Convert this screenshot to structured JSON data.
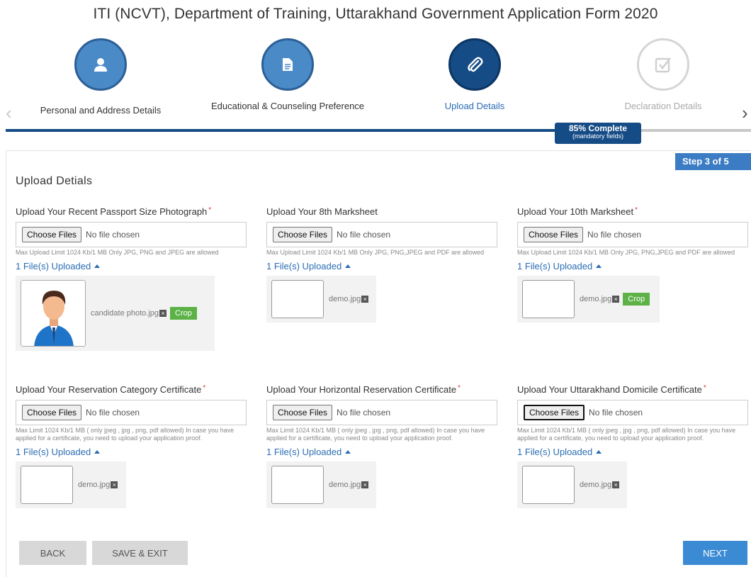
{
  "page": {
    "title": "ITI (NCVT), Department of Training, Uttarakhand Government Application Form 2020"
  },
  "stepper": {
    "steps": [
      {
        "label": "Personal and Address Details",
        "icon": "user-icon",
        "state": "done"
      },
      {
        "label": "Educational & Counseling Preference",
        "icon": "document-icon",
        "state": "done"
      },
      {
        "label": "Upload Details",
        "icon": "paperclip-icon",
        "state": "active"
      },
      {
        "label": "Declaration Details",
        "icon": "checkbox-icon",
        "state": "pending"
      }
    ],
    "progress": {
      "percent": 85,
      "label": "85% Complete",
      "sublabel": "(mandatory fields)"
    }
  },
  "form": {
    "step_badge": "Step 3 of 5",
    "section_title": "Upload Detials",
    "choose_label": "Choose Files",
    "no_file_label": "No file chosen",
    "fields": [
      {
        "label": "Upload Your Recent Passport Size Photograph",
        "required": true,
        "hint": "Max Upload Limit 1024 Kb/1 MB Only JPG, PNG and JPEG are allowed",
        "uploaded": "1 File(s) Uploaded",
        "file": "candidate photo.jpg",
        "crop": "Crop"
      },
      {
        "label": "Upload Your 8th Marksheet",
        "required": false,
        "hint": "Max Upload Limit 1024 Kb/1 MB Only JPG, PNG,JPEG and PDF are allowed",
        "uploaded": "1 File(s) Uploaded",
        "file": "demo.jpg"
      },
      {
        "label": "Upload Your 10th Marksheet",
        "required": true,
        "hint": "Max Upload Limit 1024 Kb/1 MB Only JPG, PNG,JPEG and PDF are allowed",
        "uploaded": "1 File(s) Uploaded",
        "file": "demo.jpg",
        "crop": "Crop"
      },
      {
        "label": "Upload Your Reservation Category Certificate",
        "required": true,
        "hint": "Max Limit 1024 Kb/1 MB ( only jpeg , jpg , png, pdf allowed) In case you have applied for a certificate, you need to upload your application proof.",
        "uploaded": "1 File(s) Uploaded",
        "file": "demo.jpg"
      },
      {
        "label": "Upload Your Horizontal Reservation Certificate",
        "required": true,
        "hint": "Max Limit 1024 Kb/1 MB ( only jpeg , jpg , png, pdf allowed) In case you have applied for a certificate, you need to upload your application proof.",
        "uploaded": "1 File(s) Uploaded",
        "file": "demo.jpg"
      },
      {
        "label": "Upload Your Uttarakhand Domicile Certificate",
        "required": true,
        "hint": "Max Limit 1024 Kb/1 MB ( only jpeg , jpg , png, pdf allowed) In case you have applied for a certificate, you need to upload your application proof.",
        "uploaded": "1 File(s) Uploaded",
        "file": "demo.jpg"
      }
    ]
  },
  "actions": {
    "back": "BACK",
    "save": "SAVE & EXIT",
    "next": "NEXT"
  },
  "colors": {
    "primary": "#154c86",
    "done": "#4a8ac7",
    "link": "#2a6cb3",
    "crop": "#5cb246",
    "next": "#3b8bd4"
  }
}
